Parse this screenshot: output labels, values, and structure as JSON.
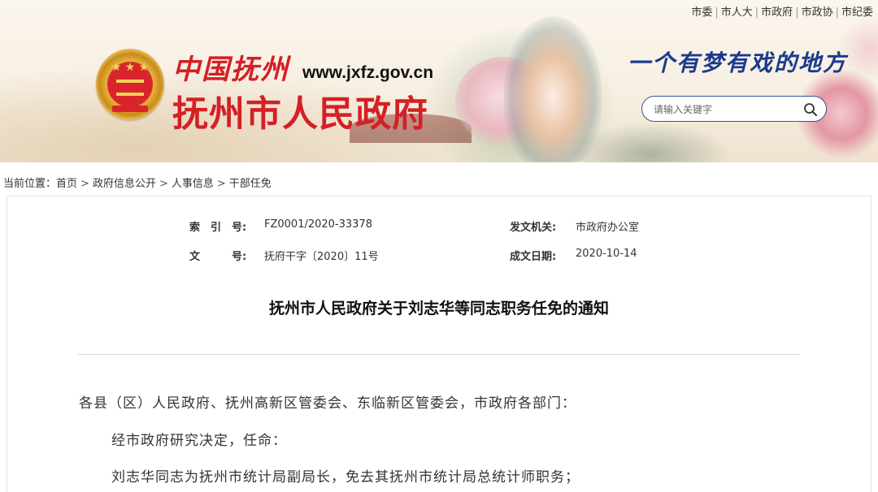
{
  "header": {
    "logo_cn": "中国抚州",
    "logo_url": "www.jxfz.gov.cn",
    "logo_main": "抚州市人民政府",
    "slogan": "一个有梦有戏的地方",
    "top_links": [
      "市委",
      "市人大",
      "市政府",
      "市政协",
      "市纪委"
    ],
    "search": {
      "placeholder": "请输入关键字"
    }
  },
  "breadcrumb": {
    "label": "当前位置：",
    "items": [
      "首页",
      "政府信息公开",
      "人事信息",
      "干部任免"
    ]
  },
  "meta": {
    "index_label": "索　引　号:",
    "index_value": "FZ0001/2020-33378",
    "issuer_label": "发文机关:",
    "issuer_value": "市政府办公室",
    "docno_label": "文　　　号:",
    "docno_value": "抚府干字〔2020〕11号",
    "date_label": "成文日期:",
    "date_value": "2020-10-14"
  },
  "document": {
    "title": "抚州市人民政府关于刘志华等同志职务任免的通知",
    "paragraphs": [
      "各县（区）人民政府、抚州高新区管委会、东临新区管委会，市政府各部门：",
      "经市政府研究决定，任命：",
      "刘志华同志为抚州市统计局副局长，免去其抚州市统计局总统计师职务；"
    ]
  }
}
